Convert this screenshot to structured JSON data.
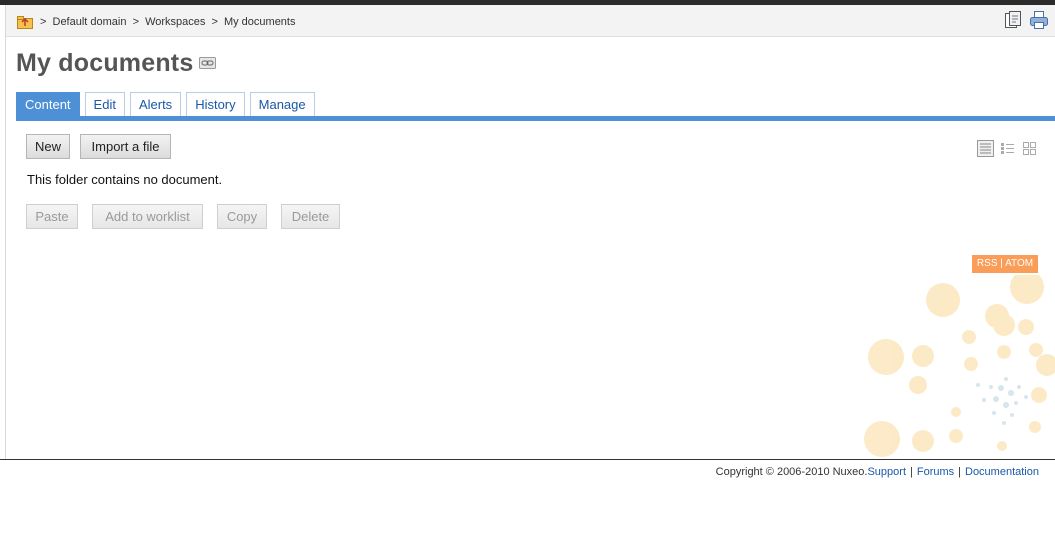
{
  "breadcrumb": {
    "separator": ">",
    "items": [
      "Default domain",
      "Workspaces",
      "My documents"
    ]
  },
  "page": {
    "title": "My documents"
  },
  "tabs": [
    {
      "label": "Content",
      "active": true
    },
    {
      "label": "Edit",
      "active": false
    },
    {
      "label": "Alerts",
      "active": false
    },
    {
      "label": "History",
      "active": false
    },
    {
      "label": "Manage",
      "active": false
    }
  ],
  "actions": {
    "new_label": "New",
    "import_label": "Import a file"
  },
  "content": {
    "empty_message": "This folder contains no document."
  },
  "selection_actions": {
    "paste_label": "Paste",
    "worklist_label": "Add to worklist",
    "copy_label": "Copy",
    "delete_label": "Delete"
  },
  "feeds": {
    "rss_label": "RSS",
    "separator": "|",
    "atom_label": "ATOM"
  },
  "footer": {
    "copyright": "Copyright © 2006-2010 Nuxeo.",
    "support_label": "Support",
    "forums_label": "Forums",
    "documentation_label": "Documentation",
    "separator": "|"
  },
  "icons": {
    "home": "folder-up-icon",
    "link": "permalink-icon",
    "export": "export-icon",
    "print": "print-icon",
    "views": [
      "list-view-icon",
      "detail-view-icon",
      "thumbnail-view-icon"
    ]
  },
  "colors": {
    "accent": "#4d90d6",
    "link": "#1a58a8",
    "rss": "#f99d59",
    "decoration": "#fbe3b5"
  }
}
